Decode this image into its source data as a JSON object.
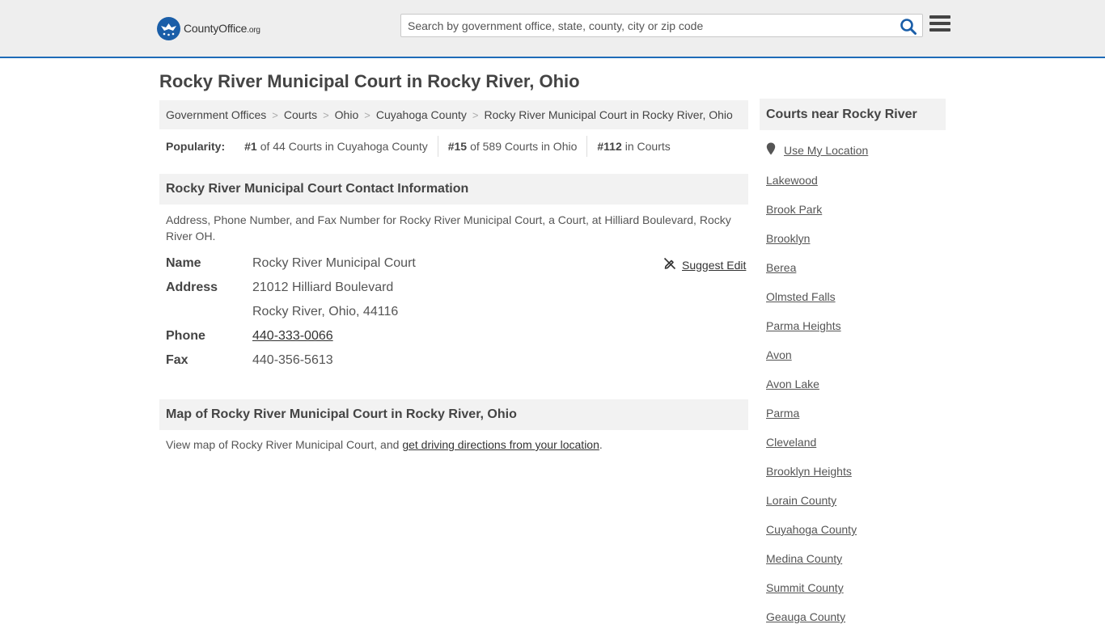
{
  "header": {
    "logo_main": "CountyOffice",
    "logo_tld": ".org",
    "search_placeholder": "Search by government office, state, county, city or zip code",
    "search_icon": "search-icon",
    "menu_icon": "hamburger-menu-icon"
  },
  "page_title": "Rocky River Municipal Court in Rocky River, Ohio",
  "breadcrumb": [
    "Government Offices",
    "Courts",
    "Ohio",
    "Cuyahoga County",
    "Rocky River Municipal Court in Rocky River, Ohio"
  ],
  "popularity": {
    "label": "Popularity:",
    "items": [
      {
        "rank": "#1",
        "text": "of 44 Courts in Cuyahoga County"
      },
      {
        "rank": "#15",
        "text": "of 589 Courts in Ohio"
      },
      {
        "rank": "#112",
        "text": "in Courts"
      }
    ]
  },
  "contact": {
    "heading": "Rocky River Municipal Court Contact Information",
    "description": "Address, Phone Number, and Fax Number for Rocky River Municipal Court, a Court, at Hilliard Boulevard, Rocky River OH.",
    "suggest_edit": "Suggest Edit",
    "name_label": "Name",
    "name_value": "Rocky River Municipal Court",
    "address_label": "Address",
    "address_line1": "21012 Hilliard Boulevard",
    "address_line2": "Rocky River, Ohio, 44116",
    "phone_label": "Phone",
    "phone_value": "440-333-0066",
    "fax_label": "Fax",
    "fax_value": "440-356-5613"
  },
  "map": {
    "heading": "Map of Rocky River Municipal Court in Rocky River, Ohio",
    "text_before": "View map of Rocky River Municipal Court, and ",
    "link": "get driving directions from your location",
    "text_after": "."
  },
  "sidebar": {
    "heading": "Courts near Rocky River",
    "use_location": "Use My Location",
    "items": [
      "Lakewood",
      "Brook Park",
      "Brooklyn",
      "Berea",
      "Olmsted Falls",
      "Parma Heights",
      "Avon",
      "Avon Lake",
      "Parma",
      "Cleveland",
      "Brooklyn Heights",
      "Lorain County",
      "Cuyahoga County",
      "Medina County",
      "Summit County",
      "Geauga County"
    ]
  },
  "colors": {
    "accent": "#1e6bb8",
    "header_bg": "#eeeeee",
    "panel_bg": "#f2f2f2"
  }
}
